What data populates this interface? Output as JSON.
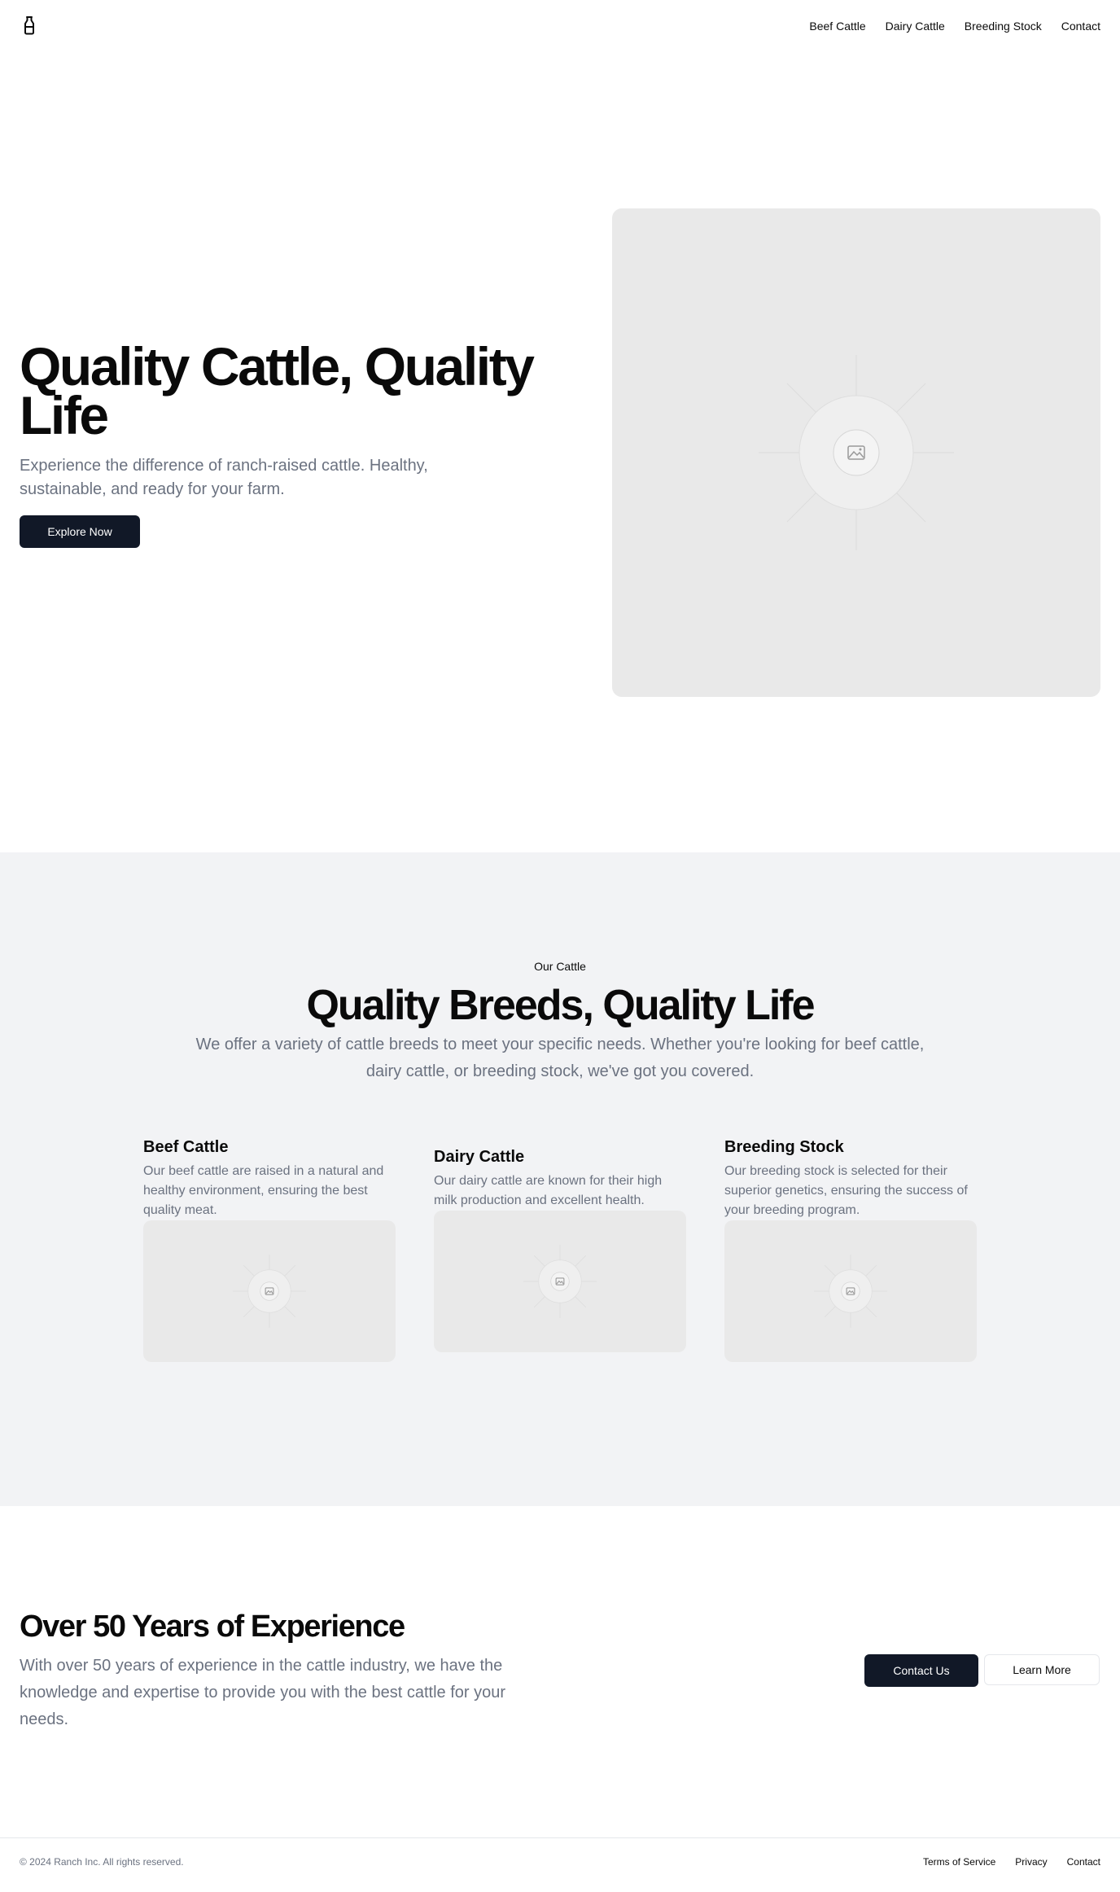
{
  "nav": {
    "logo_icon": "milk-bottle-icon",
    "items": [
      {
        "label": "Beef Cattle"
      },
      {
        "label": "Dairy Cattle"
      },
      {
        "label": "Breeding Stock"
      },
      {
        "label": "Contact"
      }
    ]
  },
  "hero": {
    "title": "Quality Cattle, Quality Life",
    "subtitle": "Experience the difference of ranch-raised cattle. Healthy, sustainable, and ready for your farm.",
    "cta_label": "Explore Now",
    "image_icon": "image-placeholder-icon"
  },
  "cattle": {
    "eyebrow": "Our Cattle",
    "title": "Quality Breeds, Quality Life",
    "subtitle": "We offer a variety of cattle breeds to meet your specific needs. Whether you're looking for beef cattle, dairy cattle, or breeding stock, we've got you covered.",
    "cards": [
      {
        "title": "Beef Cattle",
        "text": "Our beef cattle are raised in a natural and healthy environment, ensuring the best quality meat."
      },
      {
        "title": "Dairy Cattle",
        "text": "Our dairy cattle are known for their high milk production and excellent health."
      },
      {
        "title": "Breeding Stock",
        "text": "Our breeding stock is selected for their superior genetics, ensuring the success of your breeding program."
      }
    ]
  },
  "experience": {
    "title": "Over 50 Years of Experience",
    "subtitle": "With over 50 years of experience in the cattle industry, we have the knowledge and expertise to provide you with the best cattle for your needs.",
    "contact_label": "Contact Us",
    "learn_label": "Learn More"
  },
  "footer": {
    "copyright": "© 2024 Ranch Inc. All rights reserved.",
    "links": [
      {
        "label": "Terms of Service"
      },
      {
        "label": "Privacy"
      },
      {
        "label": "Contact"
      }
    ]
  },
  "colors": {
    "primary_button": "#111827",
    "muted_text": "#6b7280",
    "section_bg": "#f2f3f5",
    "placeholder_bg": "#e9e9e9"
  }
}
